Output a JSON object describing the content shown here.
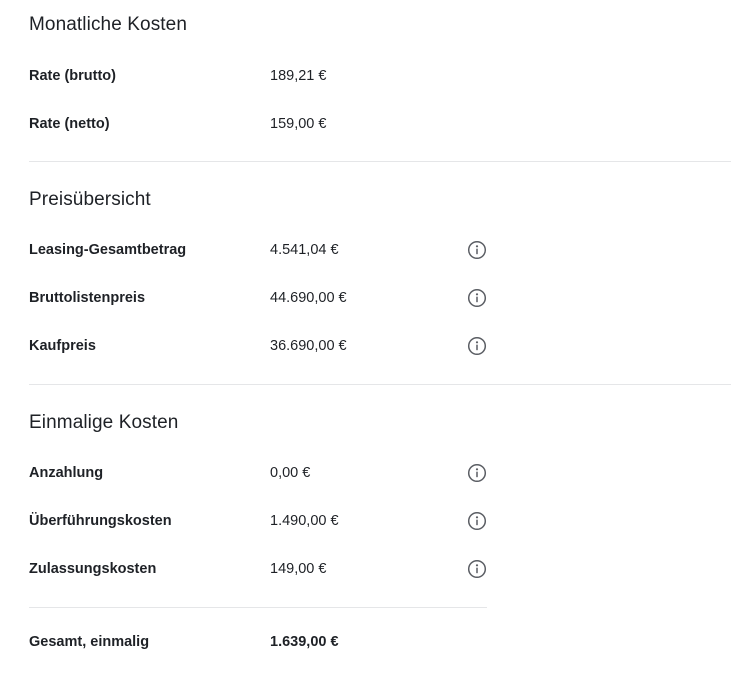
{
  "monthly": {
    "title": "Monatliche Kosten",
    "rows": [
      {
        "label": "Rate (brutto)",
        "value": "189,21 €"
      },
      {
        "label": "Rate (netto)",
        "value": "159,00 €"
      }
    ]
  },
  "prices": {
    "title": "Preisübersicht",
    "rows": [
      {
        "label": "Leasing-Gesamtbetrag",
        "value": "4.541,04 €"
      },
      {
        "label": "Bruttolistenpreis",
        "value": "44.690,00 €"
      },
      {
        "label": "Kaufpreis",
        "value": "36.690,00 €"
      }
    ]
  },
  "onetime": {
    "title": "Einmalige Kosten",
    "rows": [
      {
        "label": "Anzahlung",
        "value": "0,00 €"
      },
      {
        "label": "Überführungskosten",
        "value": "1.490,00 €"
      },
      {
        "label": "Zulassungskosten",
        "value": "149,00 €"
      }
    ],
    "total": {
      "label": "Gesamt, einmalig",
      "value": "1.639,00 €"
    }
  },
  "icons": {
    "info": "info-circle-icon"
  },
  "colors": {
    "text": "#1e2126",
    "divider": "#e5e6e8",
    "icon": "#5a5d63"
  }
}
